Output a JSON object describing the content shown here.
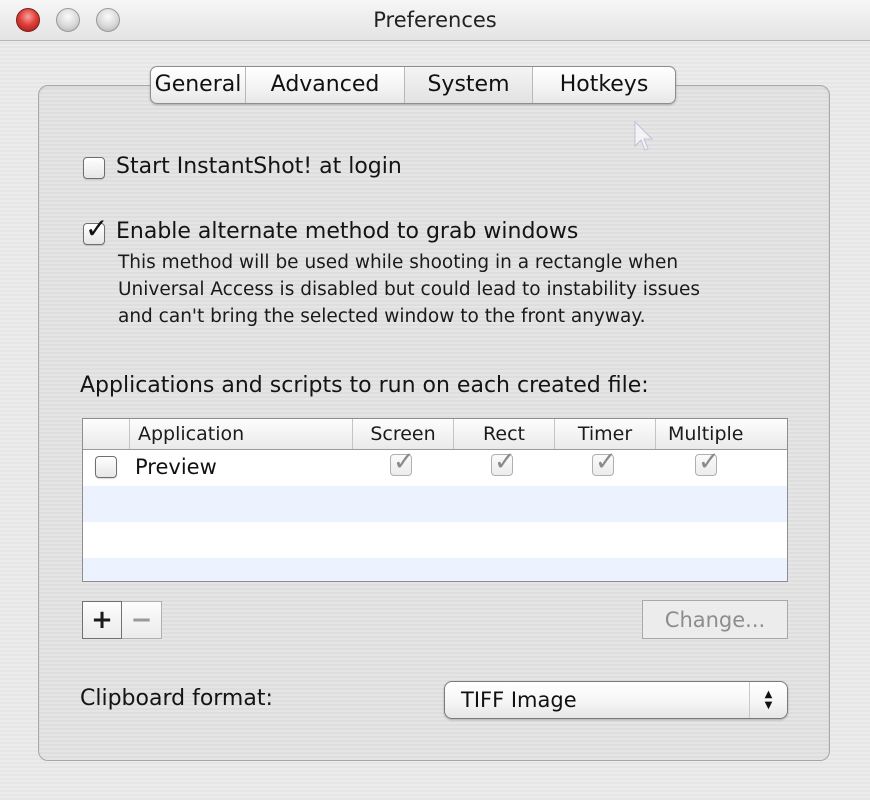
{
  "window": {
    "title": "Preferences",
    "traffic_lights": [
      "close",
      "minimize",
      "zoom"
    ]
  },
  "tabs": [
    {
      "label": "General",
      "selected": false
    },
    {
      "label": "Advanced",
      "selected": false
    },
    {
      "label": "System",
      "selected": true
    },
    {
      "label": "Hotkeys",
      "selected": false
    }
  ],
  "options": {
    "start_at_login": {
      "label": "Start InstantShot! at login",
      "checked": false
    },
    "alternate_grab": {
      "label": "Enable alternate method to grab windows",
      "checked": true,
      "description": "This method will be used while shooting in a rectangle when\nUniversal Access is disabled but could lead to instability issues\nand can't bring the selected window to the front anyway."
    }
  },
  "apps_section": {
    "heading": "Applications and scripts to run on each created file:",
    "columns": [
      "",
      "Application",
      "Screen",
      "Rect",
      "Timer",
      "Multiple"
    ],
    "rows": [
      {
        "enabled": false,
        "application": "Preview",
        "screen": true,
        "rect": true,
        "timer": true,
        "multiple": true
      }
    ],
    "add_label": "+",
    "remove_label": "−",
    "change_label": "Change..."
  },
  "clipboard": {
    "label": "Clipboard format:",
    "selected": "TIFF Image"
  },
  "icons": {
    "checkmark": "✓",
    "popup_up": "▲",
    "popup_down": "▼"
  }
}
